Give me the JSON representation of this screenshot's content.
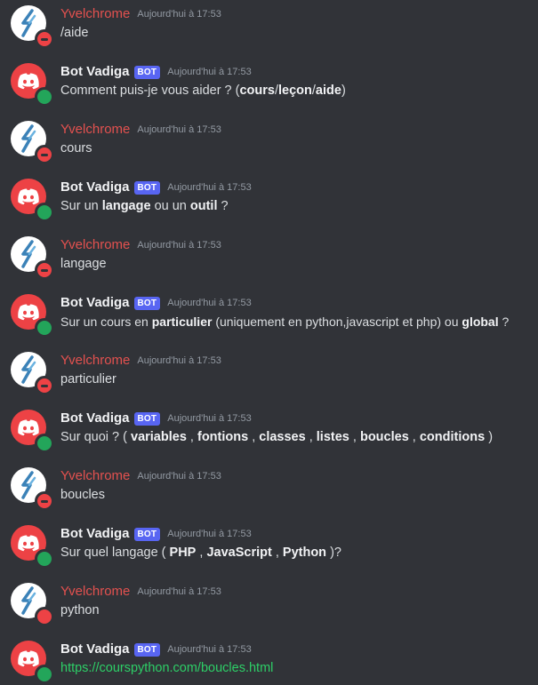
{
  "colors": {
    "background": "#313338",
    "user_name": "#e3514f",
    "bot_badge": "#5865f2",
    "online": "#23a55a",
    "dnd": "#ed4245",
    "link": "#2dcf67"
  },
  "user": {
    "name": "Yvelchrome",
    "avatar_icon": "lightning-logo-icon"
  },
  "bot": {
    "name": "Bot Vadiga",
    "badge": "BOT",
    "avatar_icon": "discord-logo-icon"
  },
  "timestamp": "Aujourd'hui à 17:53",
  "messages": [
    {
      "content": [
        "/aide"
      ]
    },
    {
      "content": [
        "Comment puis-je vous aider ? (",
        "cours",
        "/",
        "leçon",
        "/",
        "aide",
        ")"
      ]
    },
    {
      "content": [
        "cours"
      ]
    },
    {
      "content": [
        "Sur un ",
        "langage",
        " ou un ",
        "outil",
        " ?"
      ]
    },
    {
      "content": [
        "langage"
      ]
    },
    {
      "content": [
        "Sur un cours en ",
        "particulier",
        " (uniquement en python,javascript et php) ou ",
        "global",
        " ?"
      ]
    },
    {
      "content": [
        "particulier"
      ]
    },
    {
      "content": [
        "Sur quoi ? ( ",
        "variables",
        " , ",
        "fontions",
        " , ",
        "classes",
        " , ",
        "listes",
        " , ",
        "boucles",
        " , ",
        "conditions",
        " )"
      ]
    },
    {
      "content": [
        "boucles"
      ]
    },
    {
      "content": [
        "Sur quel langage ( ",
        "PHP",
        " , ",
        "JavaScript",
        " , ",
        "Python",
        " )?"
      ]
    },
    {
      "content": [
        "python"
      ]
    },
    {
      "content": [
        "https://courspython.com/boucles.html"
      ]
    }
  ]
}
